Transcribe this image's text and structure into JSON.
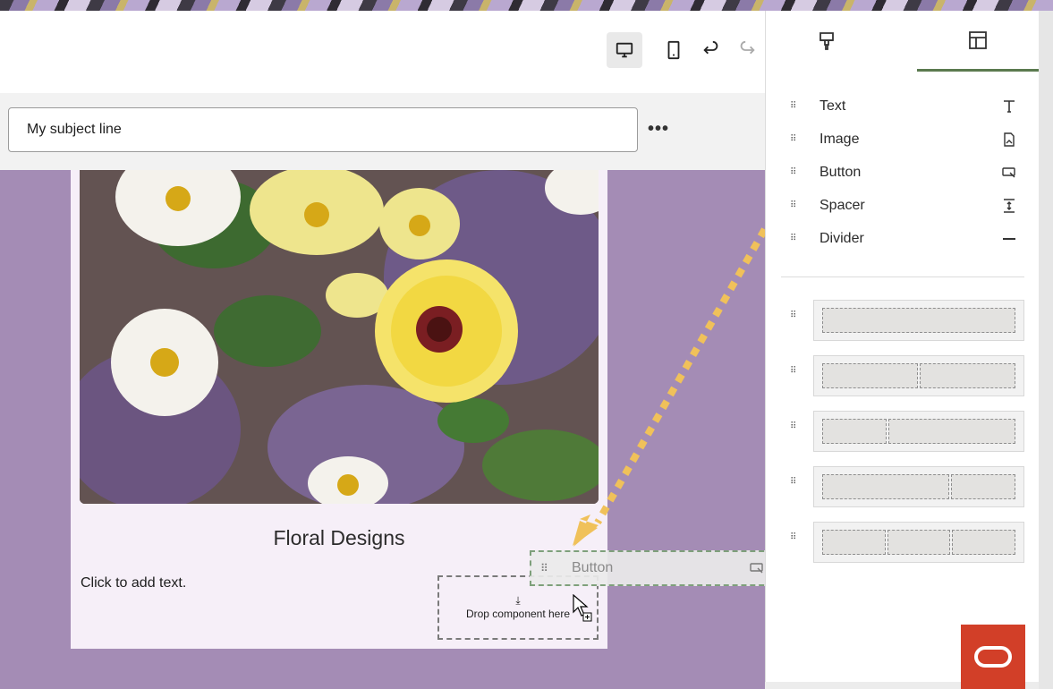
{
  "toolbar": {
    "desktop_icon": "desktop-icon",
    "mobile_icon": "mobile-icon",
    "undo_icon": "undo-icon",
    "redo_icon": "redo-icon"
  },
  "subject": {
    "value": "My subject line",
    "more_label": "•••"
  },
  "email": {
    "title": "Floral Designs",
    "text_placeholder": "Click to add text.",
    "drop_zone_label": "Drop component here"
  },
  "drag_ghost": {
    "label": "Button"
  },
  "panel": {
    "tabs": [
      "styles",
      "components"
    ],
    "components": [
      {
        "label": "Text",
        "icon": "text-icon"
      },
      {
        "label": "Image",
        "icon": "image-icon"
      },
      {
        "label": "Button",
        "icon": "button-icon"
      },
      {
        "label": "Spacer",
        "icon": "spacer-icon"
      },
      {
        "label": "Divider",
        "icon": "divider-icon"
      }
    ],
    "layouts": [
      {
        "columns": [
          1
        ]
      },
      {
        "columns": [
          1,
          1
        ]
      },
      {
        "columns": [
          1,
          2
        ]
      },
      {
        "columns": [
          2,
          1
        ]
      },
      {
        "columns": [
          1,
          1,
          1
        ]
      }
    ]
  },
  "colors": {
    "canvas_bg": "#a48cb5",
    "email_bg": "#f6eff8",
    "tab_accent": "#5b7a4f",
    "arrow": "#f0c15a",
    "brand_button": "#d23f28"
  }
}
